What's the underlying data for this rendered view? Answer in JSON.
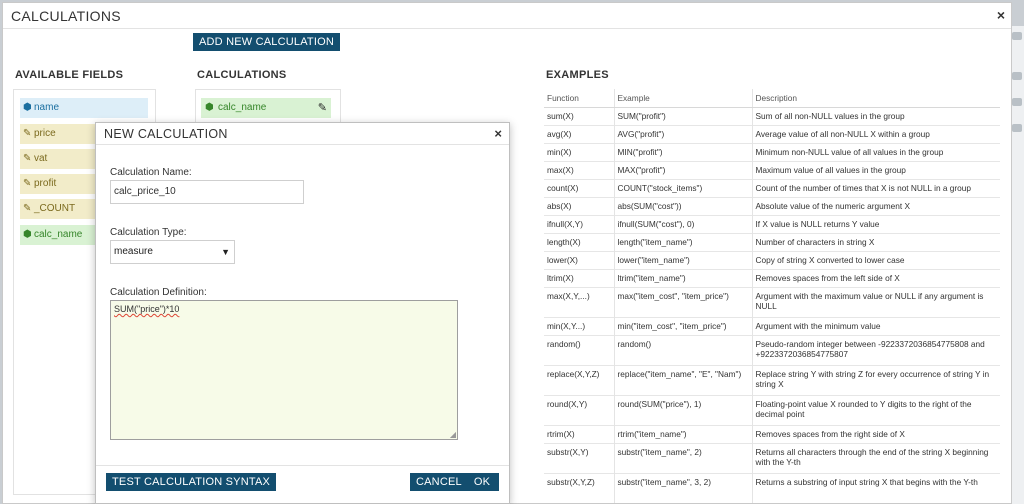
{
  "main": {
    "title": "CALCULATIONS",
    "close": "×",
    "add_button": "ADD NEW CALCULATION",
    "available_fields_heading": "AVAILABLE FIELDS",
    "calculations_heading": "CALCULATIONS",
    "examples_heading": "EXAMPLES"
  },
  "fields": [
    {
      "label": "name",
      "type": "dimension",
      "icon": "cube-icon"
    },
    {
      "label": "price",
      "type": "measure",
      "icon": "pencil-icon"
    },
    {
      "label": "vat",
      "type": "measure",
      "icon": "pencil-icon"
    },
    {
      "label": "profit",
      "type": "measure",
      "icon": "pencil-icon"
    },
    {
      "label": "_COUNT",
      "type": "measure",
      "icon": "pencil-icon"
    },
    {
      "label": "calc_name",
      "type": "calculation",
      "icon": "cube-icon"
    }
  ],
  "calculations": [
    {
      "label": "calc_name",
      "icon": "cube-icon",
      "action_icon": "pencil-edit-icon"
    }
  ],
  "examples": {
    "headers": [
      "Function",
      "Example",
      "Description"
    ],
    "rows": [
      [
        "sum(X)",
        "SUM(\"profit\")",
        "Sum of all non-NULL values in the group"
      ],
      [
        "avg(X)",
        "AVG(\"profit\")",
        "Average value of all non-NULL X within a group"
      ],
      [
        "min(X)",
        "MIN(\"profit\")",
        "Minimum non-NULL value of all values in the group"
      ],
      [
        "max(X)",
        "MAX(\"profit\")",
        "Maximum value of all values in the group"
      ],
      [
        "count(X)",
        "COUNT(\"stock_items\")",
        "Count of the number of times that X is not NULL in a group"
      ],
      [
        "abs(X)",
        "abs(SUM(\"cost\"))",
        "Absolute value of the numeric argument X"
      ],
      [
        "ifnull(X,Y)",
        "ifnull(SUM(\"cost\"), 0)",
        "If X value is NULL returns Y value"
      ],
      [
        "length(X)",
        "length(\"item_name\")",
        "Number of characters in string X"
      ],
      [
        "lower(X)",
        "lower(\"item_name\")",
        "Copy of string X converted to lower case"
      ],
      [
        "ltrim(X)",
        "ltrim(\"item_name\")",
        "Removes spaces from the left side of X"
      ],
      [
        "max(X,Y,...)",
        "max(\"item_cost\", \"item_price\")",
        "Argument with the maximum value or NULL if any argument is NULL"
      ],
      [
        "min(X,Y...)",
        "min(\"item_cost\", \"item_price\")",
        "Argument with the minimum value"
      ],
      [
        "random()",
        "random()",
        "Pseudo-random integer between -9223372036854775808 and +9223372036854775807"
      ],
      [
        "replace(X,Y,Z)",
        "replace(\"item_name\", \"E\", \"Nam\")",
        "Replace string Y with string Z for every occurrence of string Y in string X"
      ],
      [
        "round(X,Y)",
        "round(SUM(\"price\"), 1)",
        "Floating-point value X rounded to Y digits to the right of the decimal point"
      ],
      [
        "rtrim(X)",
        "rtrim(\"item_name\")",
        "Removes spaces from the right side of X"
      ],
      [
        "substr(X,Y)",
        "substr(\"item_name\", 2)",
        "Returns all characters through the end of the string X beginning with the Y-th"
      ],
      [
        "substr(X,Y,Z)",
        "substr(\"item_name\", 3, 2)",
        "Returns a substring of input string X that begins with the Y-th"
      ]
    ]
  },
  "modal": {
    "title": "NEW CALCULATION",
    "close": "×",
    "name_label": "Calculation Name:",
    "name_value": "calc_price_10",
    "type_label": "Calculation Type:",
    "type_value": "measure",
    "definition_label": "Calculation Definition:",
    "definition_value": "SUM(\"price\")*10",
    "test_button": "TEST CALCULATION SYNTAX",
    "cancel_button": "CANCEL",
    "ok_button": "OK"
  }
}
